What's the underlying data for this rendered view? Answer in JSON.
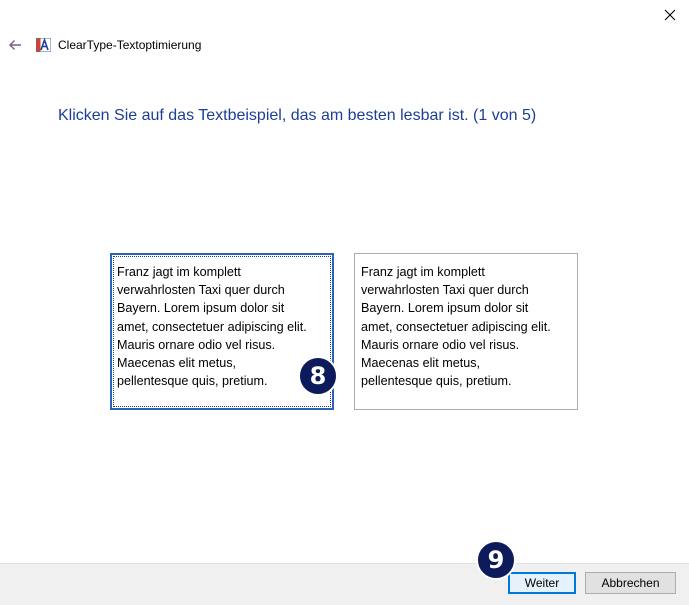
{
  "window": {
    "title": "ClearType-Textoptimierung",
    "close_icon": "close-icon",
    "back_icon": "back-arrow-icon",
    "app_icon": "cleartype-app-icon"
  },
  "main": {
    "instruction": "Klicken Sie auf das Textbeispiel, das am besten lesbar ist. (1 von 5)",
    "samples": [
      {
        "lines": [
          "Franz jagt im komplett",
          "verwahrlosten Taxi quer durch",
          "Bayern. Lorem ipsum dolor sit",
          "amet, consectetuer adipiscing elit.",
          "Mauris ornare odio vel risus.",
          "Maecenas elit metus,",
          "pellentesque quis, pretium."
        ],
        "selected": true
      },
      {
        "lines": [
          "Franz jagt im komplett",
          "verwahrlosten Taxi quer durch",
          "Bayern. Lorem ipsum dolor sit",
          "amet, consectetuer adipiscing elit.",
          "Mauris ornare odio vel risus.",
          "Maecenas elit metus,",
          "pellentesque quis, pretium."
        ],
        "selected": false
      }
    ]
  },
  "annotations": {
    "badge_sample": "8",
    "badge_next": "9"
  },
  "footer": {
    "next_label": "Weiter",
    "cancel_label": "Abbrechen"
  },
  "colors": {
    "instruction": "#1c3f95",
    "selection_border": "#2a63b8",
    "badge_fill": "#0d1a5c",
    "footer_bg": "#f0f0f0",
    "default_button_border": "#0078d7"
  }
}
